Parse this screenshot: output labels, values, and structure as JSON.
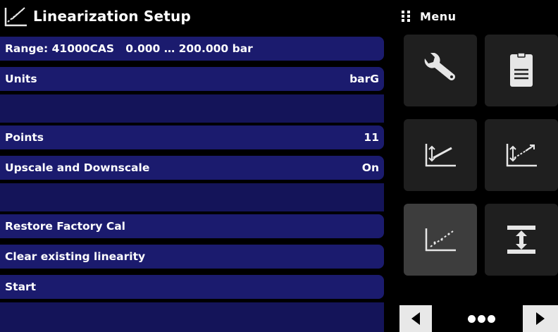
{
  "title": "Linearization Setup",
  "menu": {
    "label": "Menu"
  },
  "rows": {
    "range": {
      "label": "Range: 41000CAS",
      "value": "0.000 … 200.000 bar"
    },
    "units": {
      "label": "Units",
      "value": "barG"
    },
    "points": {
      "label": "Points",
      "value": "11"
    },
    "upscale": {
      "label": "Upscale and Downscale",
      "value": "On"
    },
    "restore": {
      "label": "Restore Factory Cal"
    },
    "clear": {
      "label": "Clear existing linearity"
    },
    "start": {
      "label": "Start"
    }
  },
  "tiles": [
    {
      "icon": "wrench-icon"
    },
    {
      "icon": "document-icon"
    },
    {
      "icon": "calibration-upscale-icon"
    },
    {
      "icon": "calibration-multipoint-icon"
    },
    {
      "icon": "linearization-icon",
      "active": true
    },
    {
      "icon": "zero-tare-icon"
    }
  ],
  "pagination": {
    "current_page": 2,
    "total_pages": 3
  },
  "colors": {
    "background": "#000000",
    "row": "#1b1b6e",
    "band": "#141459",
    "tile": "#1f1f1f",
    "tile_active": "#3d3d3d",
    "icon_light": "#e6e6e6"
  }
}
